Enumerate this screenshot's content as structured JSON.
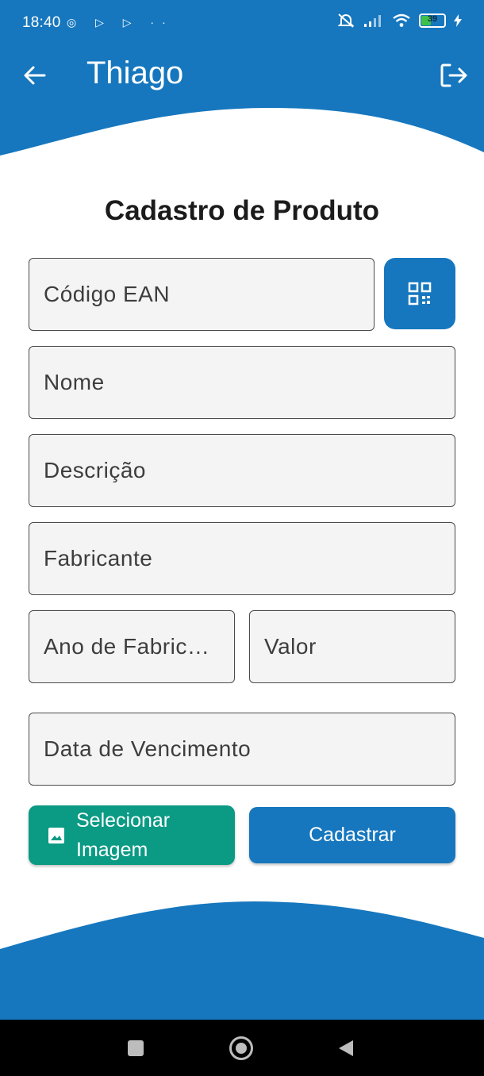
{
  "status_bar": {
    "time": "18:40",
    "left_icons": "◎ ▷ ▷ ··",
    "battery_level": "39"
  },
  "header": {
    "title": "Thiago",
    "back_icon": "arrow-left-icon",
    "logout_icon": "logout-icon"
  },
  "form": {
    "title": "Cadastro de Produto",
    "ean_placeholder": "Código EAN",
    "nome_placeholder": "Nome",
    "descricao_placeholder": "Descrição",
    "fabricante_placeholder": "Fabricante",
    "ano_placeholder": "Ano de Fabric…",
    "valor_placeholder": "Valor",
    "vencimento_placeholder": "Data de Vencimento"
  },
  "buttons": {
    "select_image_line1": "Selecionar",
    "select_image_line2": "Imagem",
    "submit": "Cadastrar"
  },
  "colors": {
    "primary": "#1677be",
    "accent": "#0b9a84",
    "field_bg": "#f4f4f4"
  }
}
